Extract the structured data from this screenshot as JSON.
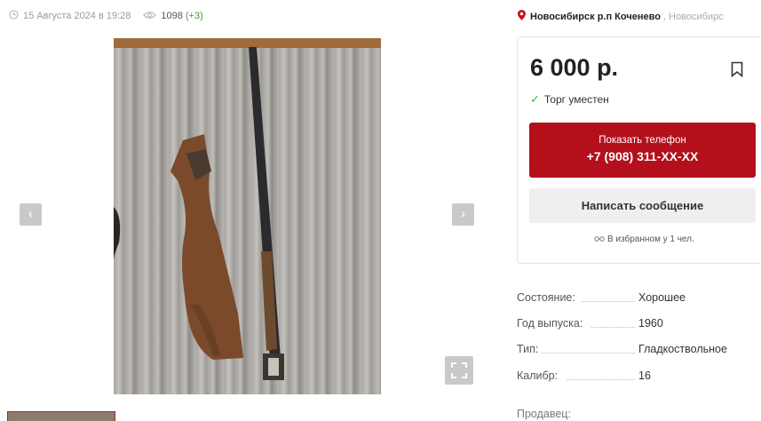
{
  "meta": {
    "date": "15 Августа 2024 в 19:28",
    "views": "1098",
    "views_delta": "(+3)"
  },
  "gallery": {
    "prev_label": "‹",
    "next_label": "›"
  },
  "location": {
    "city": "Новосибирск р.п Коченево",
    "separator": ",",
    "region": "Новосибирс"
  },
  "listing": {
    "price": "6 000 р.",
    "bargain": "Торг уместен",
    "phone_button": {
      "label": "Показать телефон",
      "number": "+7 (908) 311-XX-XX"
    },
    "message_button": "Написать сообщение",
    "favorites": "В избранном у 1 чел."
  },
  "specs": [
    {
      "key": "Состояние:",
      "value": "Хорошее"
    },
    {
      "key": "Год выпуска:",
      "value": "1960"
    },
    {
      "key": "Тип:",
      "value": "Гладкоствольное"
    },
    {
      "key": "Калибр:",
      "value": "16"
    }
  ],
  "seller_label": "Продавец:",
  "colors": {
    "accent": "#b3101c",
    "success": "#4a9a3a"
  }
}
